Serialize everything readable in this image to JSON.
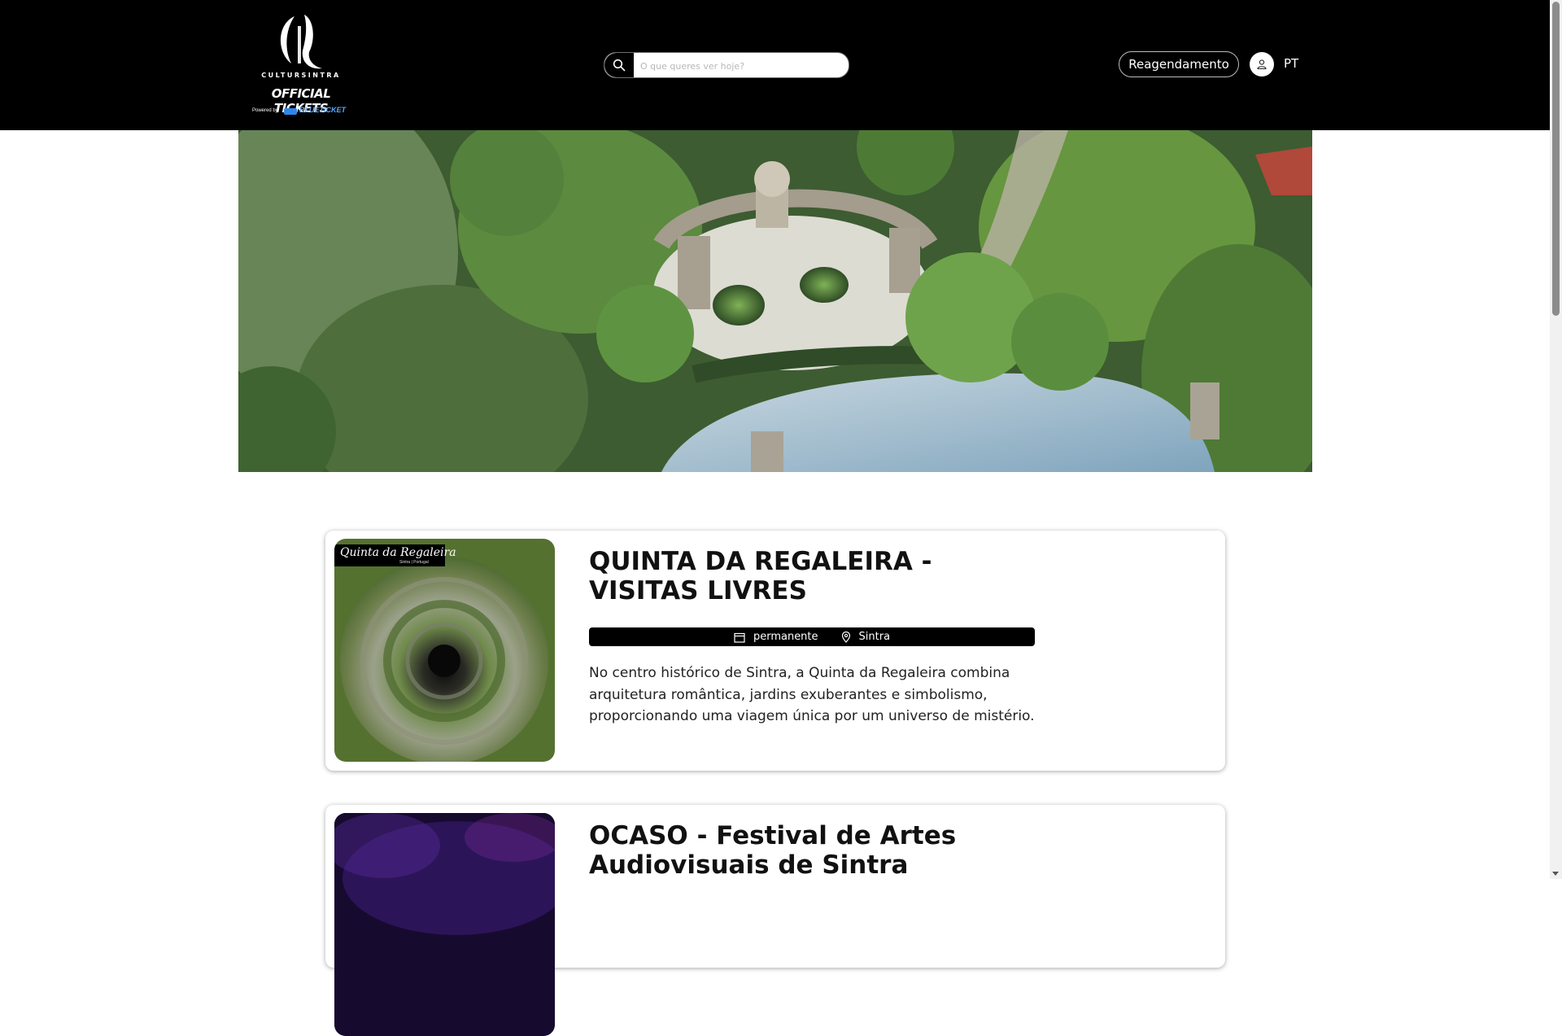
{
  "header": {
    "logo": {
      "brand": "CULTURSINTRA",
      "title": "OFFICIAL TICKETS",
      "powered_by": "Powered by",
      "partner": "BLUETICKET"
    },
    "search": {
      "placeholder": "O que queres ver hoje?",
      "icon": "search-icon"
    },
    "reschedule_label": "Reagendamento",
    "account_icon": "user-icon",
    "language": "PT"
  },
  "events": [
    {
      "title": "QUINTA DA REGALEIRA - VISITAS LIVRES",
      "thumb_title": "Quinta da Regaleira",
      "thumb_subtitle": "Sintra | Portugal",
      "date": "permanente",
      "location": "Sintra",
      "description": "No centro histórico de Sintra, a Quinta da Regaleira combina arquitetura romântica, jardins exuberantes e simbolismo, proporcionando uma viagem única por um universo de mistério."
    },
    {
      "title": "OCASO - Festival de Artes Audiovisuais de Sintra"
    }
  ],
  "colors": {
    "header_bg": "#000000",
    "page_bg": "#ffffff",
    "bar_bg": "#000000"
  }
}
